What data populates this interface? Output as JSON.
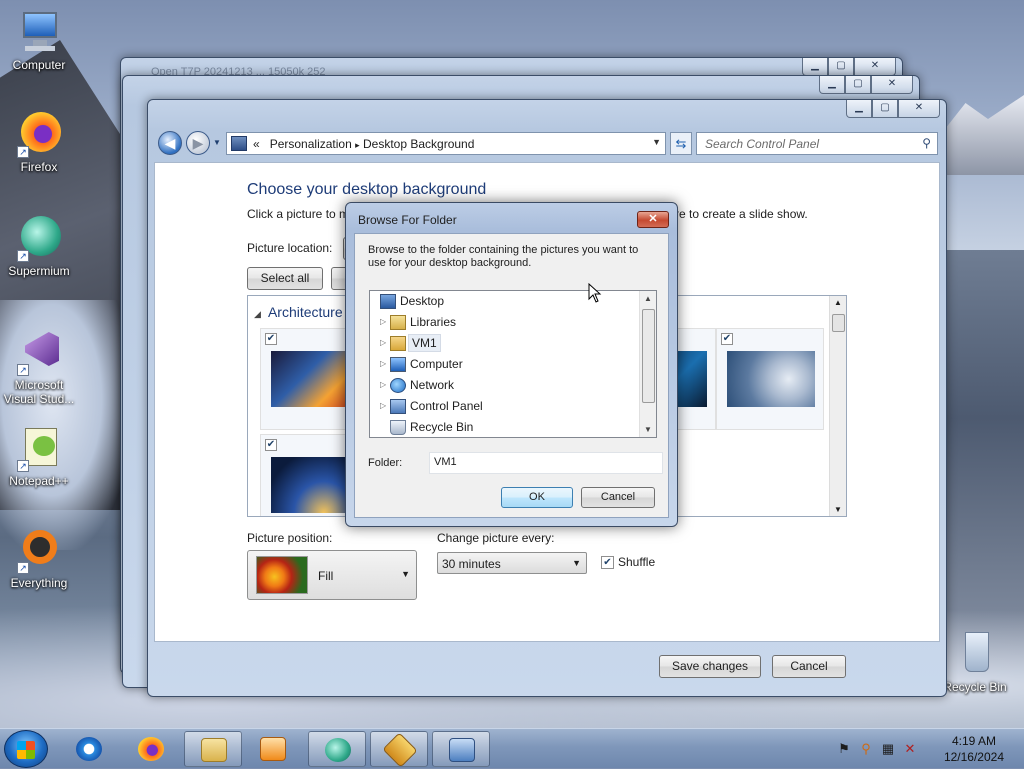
{
  "desktop": {
    "icons": [
      {
        "label": "Computer"
      },
      {
        "label": "Firefox"
      },
      {
        "label": "Supermium"
      },
      {
        "label": "Microsoft Visual Stud..."
      },
      {
        "label": "Notepad++"
      },
      {
        "label": "Everything"
      },
      {
        "label": "Recycle Bin"
      }
    ]
  },
  "background_windows": [
    {
      "title": "Open T7P 20241213 ... 15050k 252"
    }
  ],
  "main_window": {
    "breadcrumb": {
      "prefix": "«",
      "items": [
        "Personalization",
        "Desktop Background"
      ],
      "separator": "▸"
    },
    "search_placeholder": "Search Control Panel",
    "heading": "Choose your desktop background",
    "subtitle_start": "Click a picture to m",
    "subtitle_end": "re to create a slide show.",
    "picture_location_label": "Picture location:",
    "select_all_label": "Select all",
    "group_name": "Architecture",
    "picture_position_label": "Picture position:",
    "picture_position_value": "Fill",
    "change_every_label": "Change picture every:",
    "change_every_value": "30 minutes",
    "shuffle_label": "Shuffle",
    "shuffle_checked": true,
    "save_label": "Save changes",
    "cancel_label": "Cancel"
  },
  "dialog": {
    "title": "Browse For Folder",
    "close_glyph": "✕",
    "description": "Browse to the folder containing the pictures you want to use for your desktop background.",
    "tree": [
      {
        "label": "Desktop",
        "icon": "desktop-icon",
        "expandable": false,
        "level": 0
      },
      {
        "label": "Libraries",
        "icon": "libraries-icon",
        "expandable": true,
        "level": 1
      },
      {
        "label": "VM1",
        "icon": "user-folder-icon",
        "expandable": true,
        "level": 1,
        "selected": true
      },
      {
        "label": "Computer",
        "icon": "computer-icon",
        "expandable": true,
        "level": 1
      },
      {
        "label": "Network",
        "icon": "network-icon",
        "expandable": true,
        "level": 1
      },
      {
        "label": "Control Panel",
        "icon": "control-panel-icon",
        "expandable": true,
        "level": 1
      },
      {
        "label": "Recycle Bin",
        "icon": "recycle-bin-icon",
        "expandable": false,
        "level": 1
      }
    ],
    "folder_label": "Folder:",
    "folder_value": "VM1",
    "ok_label": "OK",
    "cancel_label": "Cancel"
  },
  "taskbar": {
    "apps": [
      "internet-explorer",
      "firefox",
      "file-explorer",
      "media-player",
      "supermium",
      "money-app",
      "control-panel"
    ],
    "time": "4:19 AM",
    "date": "12/16/2024"
  },
  "colors": {
    "accent": "#1e3c78",
    "window_frame": "#b6c8e0",
    "close_red": "#c54a31"
  }
}
